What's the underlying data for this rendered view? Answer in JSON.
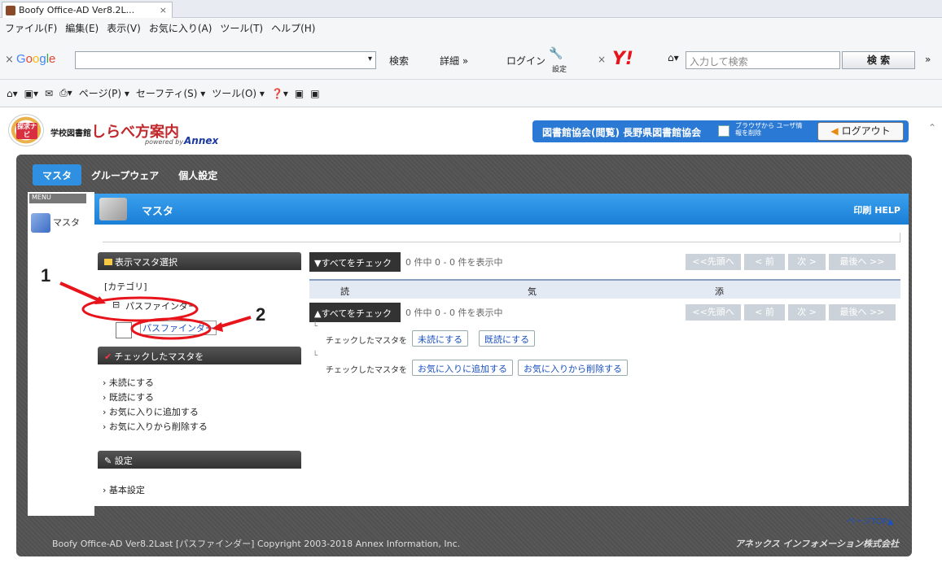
{
  "browser": {
    "tab_title": "Boofy Office-AD Ver8.2L...",
    "tab_close": "×",
    "menu": [
      "ファイル(F)",
      "編集(E)",
      "表示(V)",
      "お気に入り(A)",
      "ツール(T)",
      "ヘルプ(H)"
    ],
    "google_x": "×",
    "google_label": "Google",
    "google_search": "検索",
    "google_detail": "詳細 »",
    "login": "ログイン",
    "settings": "設定",
    "yahoo_label": "Y!",
    "yahoo_placeholder": "入力して検索",
    "yahoo_search_btn": "検 索",
    "cmd": [
      "ページ(P) ▾",
      "セーフティ(S) ▾",
      "ツール(O) ▾"
    ]
  },
  "app": {
    "logo_badge": "探求ナビ",
    "brand_prefix": "学校図書館・",
    "brand_name": "しらべ方案内",
    "powered": "powered by",
    "annex": "Annex",
    "library_bar": "図書館協会(閲覧)  長野県図書館協会",
    "browser_delete_text": "ブラウザから ユーザ情報を削除",
    "logout": "ログアウト",
    "nav": [
      "マスタ",
      "グループウェア",
      "個人設定"
    ],
    "menu_label": "MENU",
    "menu_item": "マスタ",
    "page_title": "マスタ",
    "title_right": "印刷  HELP",
    "left_panel": {
      "select_header": "表示マスタ選択",
      "category": "[カテゴリ]",
      "tree_parent": "パスファインダー",
      "tree_child": "パスファインダー",
      "checked_header": "チェックしたマスタを",
      "actions": [
        "未読にする",
        "既読にする",
        "お気に入りに追加する",
        "お気に入りから削除する"
      ],
      "settings_header": "設定",
      "settings_items": [
        "基本設定"
      ]
    },
    "list": {
      "check_all_top": "▼すべてをチェック",
      "check_all_bottom": "▲すべてをチェック",
      "count_text": "0 件中 0 - 0 件を表示中",
      "pager": [
        "<<先頭へ",
        "< 前",
        "次 >",
        "最後へ >>"
      ],
      "columns": [
        "読",
        "気",
        "添"
      ],
      "checked_label": "チェックしたマスタを",
      "btn_unread": "未読にする",
      "btn_read": "既読にする",
      "btn_fav_add": "お気に入りに追加する",
      "btn_fav_del": "お気に入りから削除する"
    },
    "page_top": "ページTOP▲",
    "footer_left": "Boofy Office-AD Ver8.2Last [パスファインダー] Copyright 2003-2018 Annex Information, Inc.",
    "footer_right": "アネックス インフォメーション株式会社"
  },
  "annotations": {
    "label_1": "1",
    "label_2": "2",
    "color": "#e8141c"
  }
}
